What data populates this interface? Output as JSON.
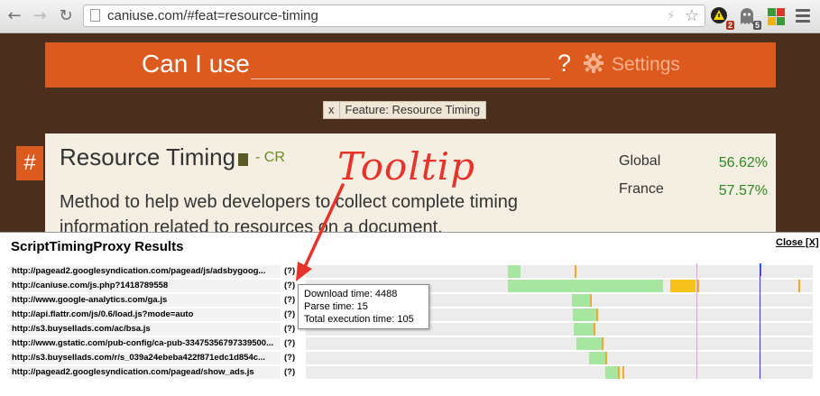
{
  "browser": {
    "url": "caniuse.com/#feat=resource-timing",
    "extension_badges": [
      "2",
      "5"
    ],
    "icons": [
      "back-icon",
      "forward-icon",
      "reload-icon",
      "page-icon",
      "bolt-icon",
      "star-icon",
      "warning-extension-icon",
      "ghost-extension-icon",
      "grid-extension-icon",
      "menu-icon"
    ]
  },
  "header": {
    "title": "Can I use",
    "question_mark": "?",
    "settings_label": "Settings"
  },
  "filter": {
    "remove": "x",
    "label": "Feature: Resource Timing"
  },
  "feature": {
    "hash": "#",
    "title": "Resource Timing",
    "status": "- CR",
    "description": "Method to help web developers to collect complete timing information related to resources on a document.",
    "usage": [
      {
        "label": "Global",
        "value": "56.62%"
      },
      {
        "label": "France",
        "value": "57.57%"
      }
    ]
  },
  "annotation": {
    "text": "Tooltip",
    "color": "#e8332a"
  },
  "panel": {
    "title": "ScriptTimingProxy Results",
    "close_label": "Close [X]",
    "rows": [
      {
        "url": "http://pagead2.googlesyndication.com/pagead/js/adsbygoog...",
        "help": "(?)"
      },
      {
        "url": "http://caniuse.com/js.php?1418789558",
        "help": "(?)"
      },
      {
        "url": "http://www.google-analytics.com/ga.js",
        "help": "(?)"
      },
      {
        "url": "http://api.flattr.com/js/0.6/load.js?mode=auto",
        "help": "(?)"
      },
      {
        "url": "http://s3.buysellads.com/ac/bsa.js",
        "help": "(?)"
      },
      {
        "url": "http://www.gstatic.com/pub-config/ca-pub-33475356797339500...",
        "help": "(?)"
      },
      {
        "url": "http://s3.buysellads.com/r/s_039a24ebeba422f871edc1d854c...",
        "help": "(?)"
      },
      {
        "url": "http://pagead2.googlesyndication.com/pagead/show_ads.js",
        "help": "(?)"
      }
    ],
    "tooltip": {
      "download": "Download time: 4488",
      "parse": "Parse time: 15",
      "exec": "Total execution time: 105"
    },
    "colors": {
      "download": "#a6e6a0",
      "parse": "#f5c21c",
      "exec": "#f0a830",
      "marker_pink": "#e0a0e0",
      "marker_red": "#c04040",
      "marker_blue": "#3a3adc"
    }
  }
}
